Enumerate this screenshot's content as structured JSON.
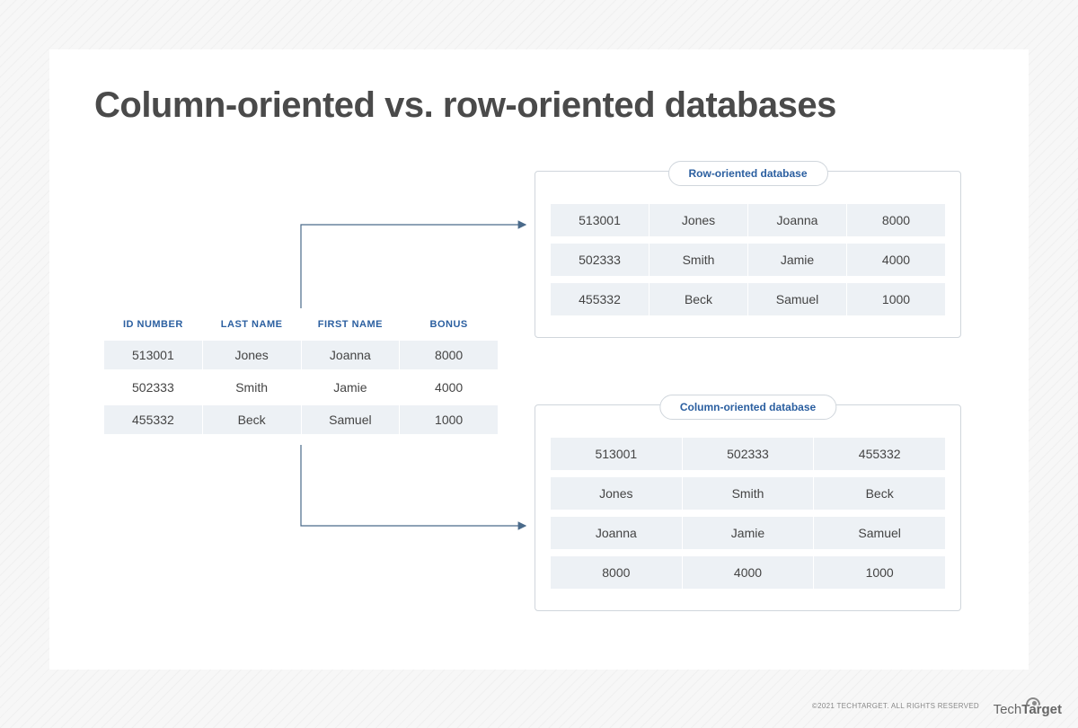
{
  "title": "Column-oriented vs. row-oriented databases",
  "source_headers": [
    "ID NUMBER",
    "LAST NAME",
    "FIRST NAME",
    "BONUS"
  ],
  "source_rows": [
    [
      "513001",
      "Jones",
      "Joanna",
      "8000"
    ],
    [
      "502333",
      "Smith",
      "Jamie",
      "4000"
    ],
    [
      "455332",
      "Beck",
      "Samuel",
      "1000"
    ]
  ],
  "row_db": {
    "label": "Row-oriented database",
    "rows": [
      [
        "513001",
        "Jones",
        "Joanna",
        "8000"
      ],
      [
        "502333",
        "Smith",
        "Jamie",
        "4000"
      ],
      [
        "455332",
        "Beck",
        "Samuel",
        "1000"
      ]
    ]
  },
  "col_db": {
    "label": "Column-oriented database",
    "rows": [
      [
        "513001",
        "502333",
        "455332"
      ],
      [
        "Jones",
        "Smith",
        "Beck"
      ],
      [
        "Joanna",
        "Jamie",
        "Samuel"
      ],
      [
        "8000",
        "4000",
        "1000"
      ]
    ]
  },
  "copyright": "©2021 TECHTARGET. ALL RIGHTS RESERVED",
  "logo_left": "Tech",
  "logo_right": "Target"
}
